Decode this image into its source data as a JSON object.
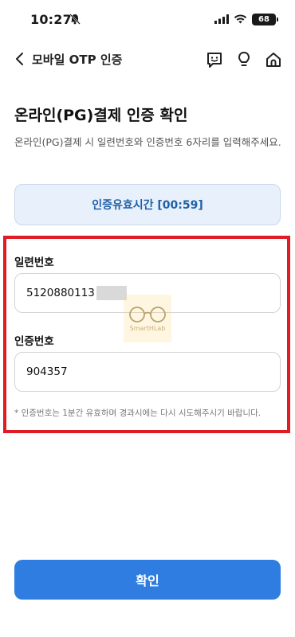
{
  "status_bar": {
    "time": "10:27",
    "battery": "68",
    "icons": [
      "bell-off-icon",
      "signal-icon",
      "wifi-icon",
      "battery-icon"
    ]
  },
  "header": {
    "title": "모바일 OTP 인증",
    "icons": [
      "back-chevron-icon",
      "chat-face-icon",
      "lightbulb-icon",
      "home-icon"
    ]
  },
  "main": {
    "title": "온라인(PG)결제 인증 확인",
    "description": "온라인(PG)결제 시 일련번호와 인증번호 6자리를 입력해주세요.",
    "timer_text": "인증유효시간 [00:59]",
    "serial": {
      "label": "일련번호",
      "value": "5120880113"
    },
    "otp": {
      "label": "인증번호",
      "value": "904357"
    },
    "note": "* 인증번호는 1분간 유효하며 경과시에는 다시 시도해주시기 바랍니다.",
    "watermark": "SmartHLab"
  },
  "footer": {
    "confirm_label": "확인"
  },
  "colors": {
    "accent": "#2f7de1",
    "timer_bg": "#e8f1fb",
    "timer_text": "#1f5fa8",
    "highlight": "#e01b24"
  }
}
